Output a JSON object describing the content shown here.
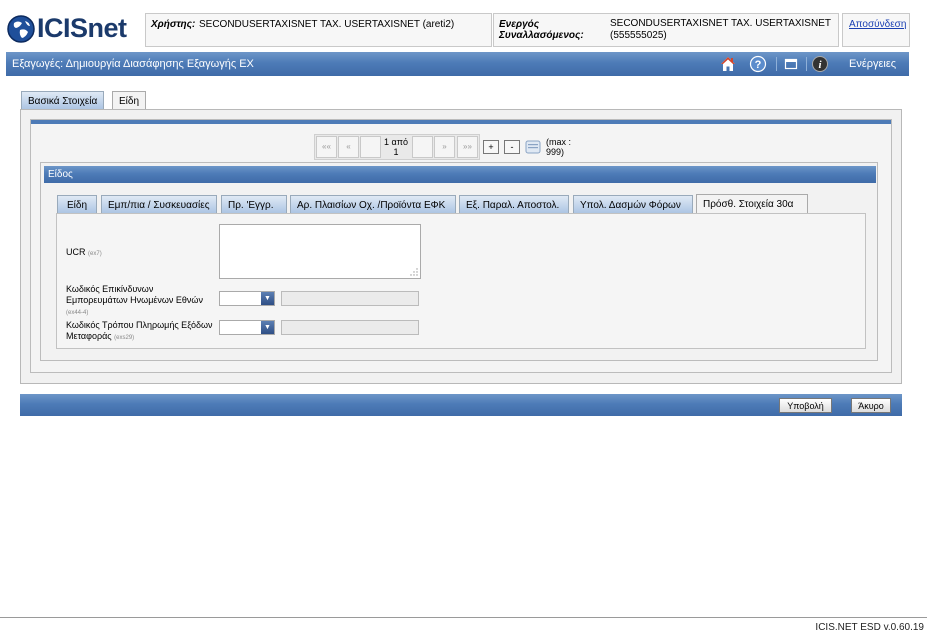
{
  "header": {
    "logo_text": "ICISnet",
    "user_label": "Χρήστης:",
    "user_value": "SECONDUSERTAXISNET TAX. USERTAXISNET (areti2)",
    "trader_label": "Ενεργός Συναλλασόμενος:",
    "trader_value": "SECONDUSERTAXISNET TAX. USERTAXISNET (555555025)",
    "logout": "Αποσύνδεση"
  },
  "titlebar": {
    "title": "Εξαγωγές: Δημιουργία Διασάφησης Εξαγωγής ΕΧ",
    "actions": "Ενέργειες"
  },
  "main_tabs": [
    {
      "label": "Βασικά Στοιχεία",
      "active": false
    },
    {
      "label": "Είδη",
      "active": true
    }
  ],
  "pager": {
    "first": "««",
    "prev": "«",
    "page_info": "1 από 1",
    "next": "»",
    "last": "»»",
    "add": "+",
    "remove": "-",
    "max_info": "(max : 999)"
  },
  "section": {
    "title": "Είδος"
  },
  "sub_tabs": [
    {
      "label": "Είδη",
      "active": false
    },
    {
      "label": "Εμπ/πια / Συσκευασίες",
      "active": false
    },
    {
      "label": "Πρ. 'Εγγρ.",
      "active": false
    },
    {
      "label": "Αρ. Πλαισίων Οχ. /Προϊόντα ΕΦΚ",
      "active": false
    },
    {
      "label": "Εξ. Παραλ. Αποστολ.",
      "active": false
    },
    {
      "label": "Υπολ. Δασμών Φόρων",
      "active": false
    },
    {
      "label": "Πρόσθ. Στοιχεία 30α",
      "active": true
    }
  ],
  "form": {
    "ucr_label": "UCR",
    "ucr_code": "(ex7)",
    "ucr_value": "",
    "dangerous_goods_label": "Κωδικός Επικίνδυνων Εμπορευμάτων Ηνωμένων Εθνών",
    "dangerous_goods_code": "(ex44-4)",
    "payment_method_label": "Κωδικός Τρόπου Πληρωμής Εξόδων Μεταφοράς",
    "payment_method_code": "(exs29)"
  },
  "buttons": {
    "submit": "Υποβολή",
    "cancel": "Άκυρο"
  },
  "footer": {
    "version": "ICIS.NET ESD v.0.60.19"
  },
  "colors": {
    "bar_blue": "#4d7bb7",
    "logo_blue": "#1b3a6b",
    "link_blue": "#1a3fb2"
  }
}
